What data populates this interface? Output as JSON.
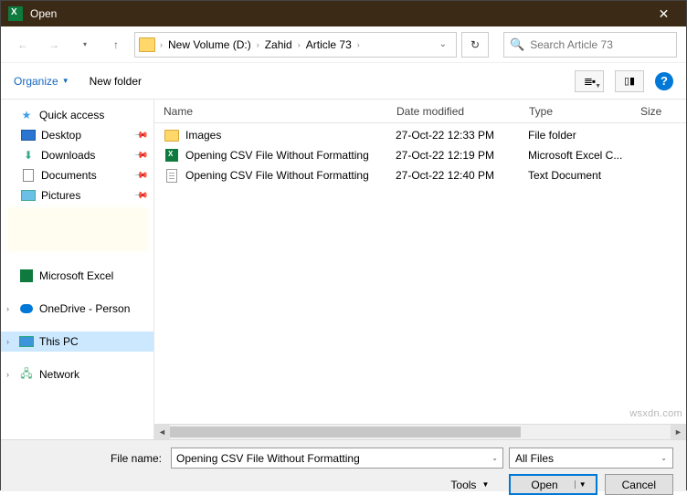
{
  "window": {
    "title": "Open"
  },
  "breadcrumbs": {
    "vol": "New Volume (D:)",
    "user": "Zahid",
    "folder": "Article 73"
  },
  "search": {
    "placeholder": "Search Article 73"
  },
  "commands": {
    "organize": "Organize",
    "newfolder": "New folder"
  },
  "sidebar": {
    "quick": "Quick access",
    "desktop": "Desktop",
    "downloads": "Downloads",
    "documents": "Documents",
    "pictures": "Pictures",
    "excel": "Microsoft Excel",
    "onedrive": "OneDrive - Person",
    "thispc": "This PC",
    "network": "Network"
  },
  "columns": {
    "name": "Name",
    "date": "Date modified",
    "type": "Type",
    "size": "Size"
  },
  "files": [
    {
      "name": "Images",
      "date": "27-Oct-22 12:33 PM",
      "type": "File folder",
      "kind": "folder"
    },
    {
      "name": "Opening CSV File Without Formatting",
      "date": "27-Oct-22 12:19 PM",
      "type": "Microsoft Excel C...",
      "kind": "xls"
    },
    {
      "name": "Opening CSV File Without Formatting",
      "date": "27-Oct-22 12:40 PM",
      "type": "Text Document",
      "kind": "txt"
    }
  ],
  "bottom": {
    "fnlabel": "File name:",
    "fnvalue": "Opening CSV File Without Formatting",
    "filter": "All Files",
    "tools": "Tools",
    "open": "Open",
    "cancel": "Cancel"
  },
  "watermark": "wsxdn.com"
}
